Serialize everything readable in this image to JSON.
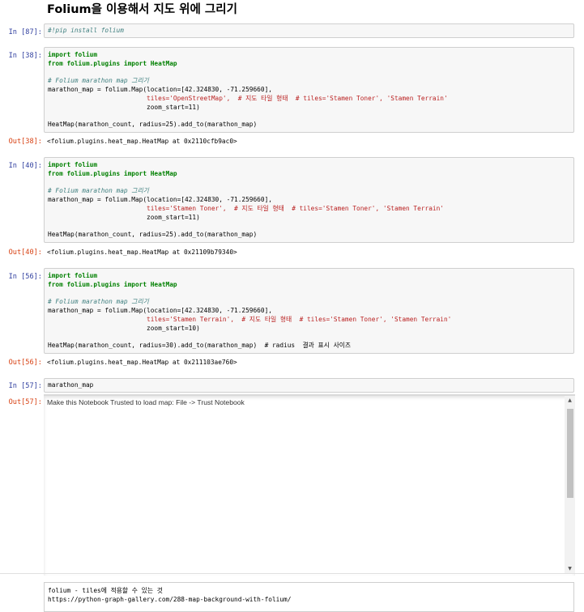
{
  "heading": "Folium을 이용해서 지도 위에 그리기",
  "cells": [
    {
      "in_prompt": "In [87]:",
      "code_lines": [
        "#!pip install folium"
      ]
    },
    {
      "in_prompt": "In [38]:",
      "code_lines": [
        "import folium",
        "from folium.plugins import HeatMap",
        "",
        "# Folium marathon map 그리기",
        "marathon_map = folium.Map(location=[42.324830, -71.259660],",
        "                          tiles='OpenStreetMap',  # 지도 타일 형태  # tiles='Stamen Toner', 'Stamen Terrain'",
        "                          zoom_start=11)",
        "",
        "HeatMap(marathon_count, radius=25).add_to(marathon_map)"
      ],
      "out_prompt": "Out[38]:",
      "out_text": "<folium.plugins.heat_map.HeatMap at 0x2110cfb9ac0>"
    },
    {
      "in_prompt": "In [40]:",
      "code_lines": [
        "import folium",
        "from folium.plugins import HeatMap",
        "",
        "# Folium marathon map 그리기",
        "marathon_map = folium.Map(location=[42.324830, -71.259660],",
        "                          tiles='Stamen Toner',  # 지도 타일 형태  # tiles='Stamen Toner', 'Stamen Terrain'",
        "                          zoom_start=11)",
        "",
        "HeatMap(marathon_count, radius=25).add_to(marathon_map)"
      ],
      "out_prompt": "Out[40]:",
      "out_text": "<folium.plugins.heat_map.HeatMap at 0x21109b79340>"
    },
    {
      "in_prompt": "In [56]:",
      "code_lines": [
        "import folium",
        "from folium.plugins import HeatMap",
        "",
        "# Folium marathon map 그리기",
        "marathon_map = folium.Map(location=[42.324830, -71.259660],",
        "                          tiles='Stamen Terrain',  # 지도 타일 형태  # tiles='Stamen Toner', 'Stamen Terrain'",
        "                          zoom_start=10)",
        "",
        "HeatMap(marathon_count, radius=30).add_to(marathon_map)  # radius  결과 표시 사이즈"
      ],
      "out_prompt": "Out[56]:",
      "out_text": "<folium.plugins.heat_map.HeatMap at 0x211103ae760>"
    },
    {
      "in_prompt": "In [57]:",
      "code_lines": [
        "marathon_map"
      ],
      "out_prompt": "Out[57]:",
      "out_text": "Make this Notebook Trusted to load map: File -> Trust Notebook"
    }
  ],
  "bottom_cell": {
    "lines": [
      "folium - tiles에 적용할 수 있는 것",
      "https://python-graph-gallery.com/288-map-background-with-folium/"
    ]
  },
  "colors": {
    "in_prompt": "#303f9f",
    "out_prompt": "#d84315",
    "keyword": "#008000",
    "comment": "#408080",
    "string": "#ba2121"
  }
}
